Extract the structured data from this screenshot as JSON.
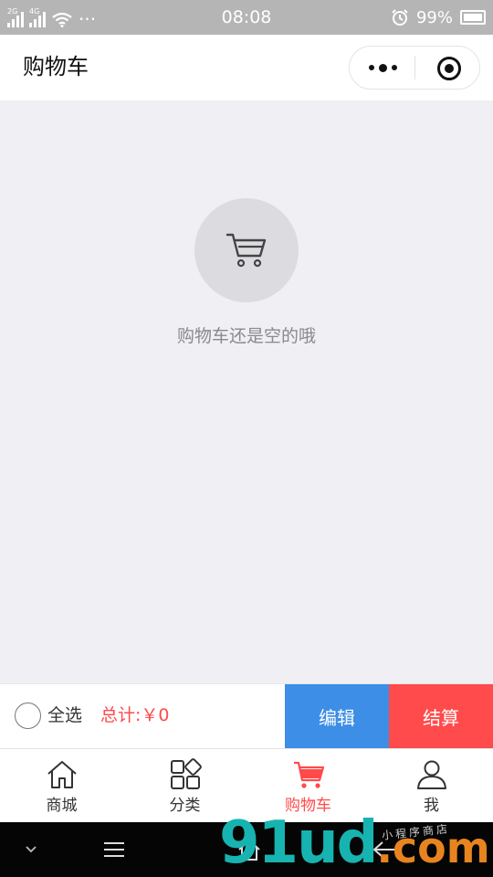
{
  "status_bar": {
    "network_1": "2G",
    "network_2": "4G",
    "dots": "···",
    "time": "08:08",
    "battery": "99%"
  },
  "nav": {
    "title": "购物车"
  },
  "empty": {
    "message": "购物车还是空的哦"
  },
  "cart_bar": {
    "select_all": "全选",
    "total": "总计:￥0",
    "edit": "编辑",
    "checkout": "结算"
  },
  "tabs": [
    {
      "label": "商城",
      "icon": "home-icon"
    },
    {
      "label": "分类",
      "icon": "category-icon"
    },
    {
      "label": "购物车",
      "icon": "cart-icon"
    },
    {
      "label": "我",
      "icon": "user-icon"
    }
  ],
  "colors": {
    "accent_red": "#ff4b4b",
    "edit_blue": "#3d8ee6",
    "background": "#efeff4"
  },
  "watermark": {
    "main": "91ud",
    "suffix": ".com",
    "sub": "小程序商店"
  }
}
